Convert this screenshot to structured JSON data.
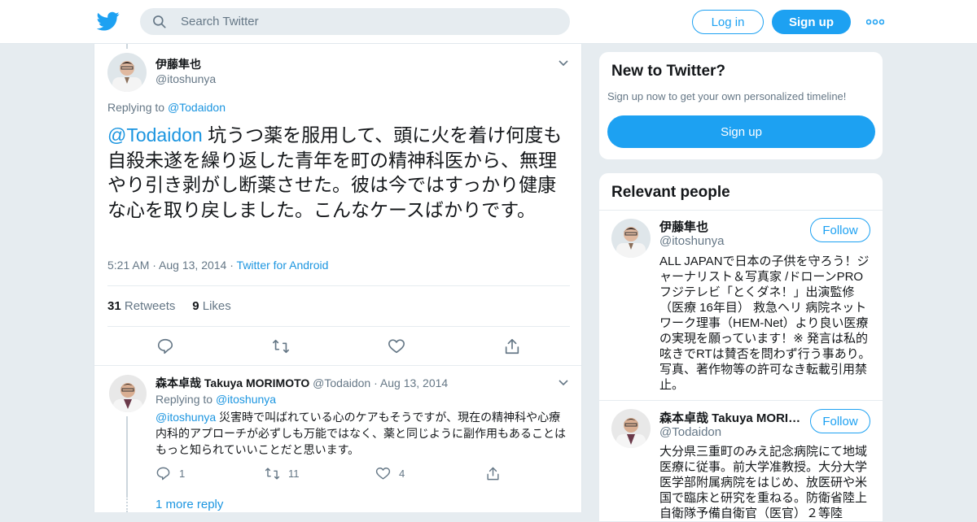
{
  "nav": {
    "search_placeholder": "Search Twitter",
    "login_label": "Log in",
    "signup_label": "Sign up",
    "logo_icon": "twitter-bird-icon",
    "more_icon": "more-dots-icon"
  },
  "tweet": {
    "author_name": "伊藤隼也",
    "author_handle": "@itoshunya",
    "replying_prefix": "Replying to",
    "replying_to": "@Todaidon",
    "mention": "@Todaidon",
    "text": " 坑うつ薬を服用して、頭に火を着け何度も自殺未遂を繰り返した青年を町の精神科医から、無理やり引き剥がし断薬させた。彼は今ではすっかり健康な心を取り戻しました。こんなケースばかりです。",
    "time": "5:21 AM",
    "date": "Aug 13, 2014",
    "source": "Twitter for Android",
    "retweets_count": "31",
    "retweets_label": "Retweets",
    "likes_count": "9",
    "likes_label": "Likes"
  },
  "reply": {
    "author_name": "森本卓哉 Takuya MORIMOTO",
    "author_handle": "@Todaidon",
    "date": "Aug 13, 2014",
    "replying_prefix": "Replying to",
    "replying_to": "@itoshunya",
    "mention": "@itoshunya",
    "text": " 災害時で叫ばれている心のケアもそうですが、現在の精神科や心療内科的アプローチが必ずしも万能ではなく、薬と同じように副作用もあることはもっと知られていいことだと思います。",
    "reply_count": "1",
    "retweet_count": "11",
    "like_count": "4",
    "more_replies": "1 more reply"
  },
  "sidebar": {
    "new_title": "New to Twitter?",
    "new_subtitle": "Sign up now to get your own personalized timeline!",
    "signup_label": "Sign up",
    "relevant_title": "Relevant people",
    "people": [
      {
        "name": "伊藤隼也",
        "handle": "@itoshunya",
        "follow_label": "Follow",
        "bio": "ALL JAPANで日本の子供を守ろう！ジャーナリスト＆写真家 /ドローンPRO フジテレビ「とくダネ！」出演監修（医療 16年目） 救急ヘリ 病院ネットワーク理事（HEM-Net）より良い医療の実現を願っています！※ 発言は私的呟きでRTは賛否を問わず行う事あり。写真、著作物等の許可なき転載引用禁止。"
      },
      {
        "name": "森本卓哉 Takuya MORIMOTO",
        "handle": "@Todaidon",
        "follow_label": "Follow",
        "bio": "大分県三重町のみえ記念病院にて地域医療に従事。前大学准教授。大分大学医学部附属病院をはじめ、放医研や米国で臨床と研究を重ねる。防衛省陸上自衛隊予備自衛官（医官）２等陸"
      }
    ]
  },
  "colors": {
    "brand": "#1da1f2",
    "link": "#1b95e0",
    "muted": "#657786"
  }
}
